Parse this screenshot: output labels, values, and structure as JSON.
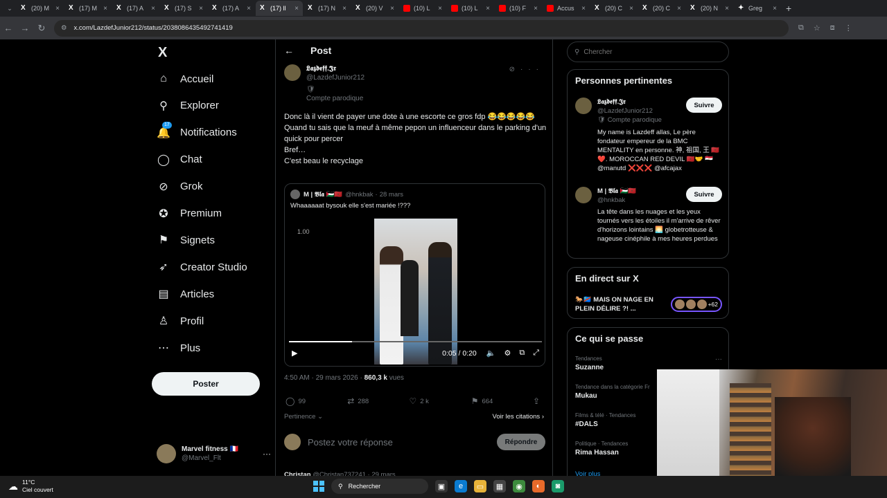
{
  "browser": {
    "tabs": [
      {
        "icon": "x-logo",
        "title": "(20) M"
      },
      {
        "icon": "x-logo",
        "title": "(17) M"
      },
      {
        "icon": "x-logo",
        "title": "(17) A"
      },
      {
        "icon": "x-logo",
        "title": "(17) S"
      },
      {
        "icon": "x-logo",
        "title": "(17) A"
      },
      {
        "icon": "x-logo",
        "title": "(17) ll"
      },
      {
        "icon": "x-logo",
        "title": "(17) N"
      },
      {
        "icon": "x-logo",
        "title": "(20) V"
      },
      {
        "icon": "youtube-logo",
        "title": "(10) L"
      },
      {
        "icon": "youtube-logo",
        "title": "(10) L"
      },
      {
        "icon": "youtube-logo",
        "title": "(10) F"
      },
      {
        "icon": "news-logo",
        "title": "Accus"
      },
      {
        "icon": "x-logo",
        "title": "(20) C"
      },
      {
        "icon": "x-logo",
        "title": "(20) C"
      },
      {
        "icon": "x-logo",
        "title": "(20) N"
      },
      {
        "icon": "greg-logo",
        "title": "Greg"
      }
    ],
    "active_tab": 5,
    "url": "x.com/LazdefJunior212/status/2038086435492741419"
  },
  "sidebar": {
    "logo": "X",
    "items": [
      {
        "label": "Accueil",
        "icon": "home-icon",
        "glyph": "⌂"
      },
      {
        "label": "Explorer",
        "icon": "search-icon",
        "glyph": "⚲"
      },
      {
        "label": "Notifications",
        "icon": "bell-icon",
        "glyph": "🔔",
        "badge": "17"
      },
      {
        "label": "Chat",
        "icon": "chat-icon",
        "glyph": "◯"
      },
      {
        "label": "Grok",
        "icon": "grok-icon",
        "glyph": "⊘"
      },
      {
        "label": "Premium",
        "icon": "premium-icon",
        "glyph": "✪"
      },
      {
        "label": "Signets",
        "icon": "bookmark-icon",
        "glyph": "⚑"
      },
      {
        "label": "Creator Studio",
        "icon": "rocket-icon",
        "glyph": "➶"
      },
      {
        "label": "Articles",
        "icon": "article-icon",
        "glyph": "▤"
      },
      {
        "label": "Profil",
        "icon": "profile-icon",
        "glyph": "♙"
      },
      {
        "label": "Plus",
        "icon": "more-icon",
        "glyph": "⋯"
      }
    ],
    "post_button": "Poster",
    "account": {
      "name": "Marvel fitness 🇫🇷",
      "handle": "@Marvel_Flt"
    }
  },
  "post": {
    "header_title": "Post",
    "author_name": "𝕷𝖆𝖟𝖉𝖊𝖋𝖋.𝕵𝖗",
    "author_handle": "@LazdefJunior212",
    "parody_label": "Compte parodique",
    "text_lines": [
      "Donc là il vient de payer une dote à une escorte ce gros fdp 😂😂😂😂😂",
      "Quand tu sais que la meuf à même pepon un influenceur dans le parking d'un quick pour percer",
      "Bref…",
      "C'est beau le recyclage"
    ],
    "quote": {
      "name": "M | 𝕭𝖑𝖆 🇵🇸🇲🇦",
      "handle": "@hnkbak",
      "date": "28 mars",
      "text": "Whaaaaaat bysouk elle s'est mariée !???",
      "video_speed": "1.00",
      "video_time": "0:05 / 0:20",
      "progress": 0.25
    },
    "timestamp": "4:50 AM · 29 mars 2026 ·",
    "views_count": "860,3 k",
    "views_label": "vues",
    "stats": {
      "replies": "99",
      "reposts": "288",
      "likes": "2 k",
      "bookmarks": "664"
    },
    "relevance": "Pertinence",
    "citations": "Voir les citations",
    "reply_placeholder": "Postez votre réponse",
    "reply_button": "Répondre",
    "next_author": "Christan",
    "next_meta": "@Christan737241 · 29 mars"
  },
  "right": {
    "search_placeholder": "Chercher",
    "relevant_title": "Personnes pertinentes",
    "people": [
      {
        "name": "𝕷𝖆𝖟𝖉𝖊𝖋𝖋.𝕵𝖗",
        "handle": "@LazdefJunior212",
        "badge": "🛡 Compte parodique",
        "follow": "Suivre",
        "bio": "My name is Lazdeff allas, Le père fondateur empereur de la BMC MENTALITY en personne. 神, 祖国, 王 🇲🇦❤️. MOROCCAN RED DEVIL 🇲🇦🤝 🇪🇬 @manutd ❌❌❌ @afcajax"
      },
      {
        "name": "M | 𝕭𝖑𝖆 🇵🇸🇲🇦",
        "handle": "@hnkbak",
        "follow": "Suivre",
        "bio": "La tête dans les nuages et les yeux tournés vers les étoiles il m'arrive de rêver d'horizons lointains 🌅 globetrotteuse & nageuse cinéphile à mes heures perdues"
      }
    ],
    "live_title": "En direct sur X",
    "live_text": "🐎🇨🇩 MAIS ON NAGE EN PLEIN DÉLIRE ?! ...",
    "live_count": "+62",
    "happening_title": "Ce qui se passe",
    "trends": [
      {
        "category": "Tendances",
        "name": "Suzanne"
      },
      {
        "category": "Tendance dans la catégorie Fr",
        "name": "Mukau"
      },
      {
        "category": "Films & télé · Tendances",
        "name": "#DALS"
      },
      {
        "category": "Politique · Tendances",
        "name": "Rima Hassan"
      }
    ],
    "see_more": "Voir plus"
  },
  "taskbar": {
    "temp": "11°C",
    "weather": "Ciel couvert",
    "search": "Rechercher"
  }
}
